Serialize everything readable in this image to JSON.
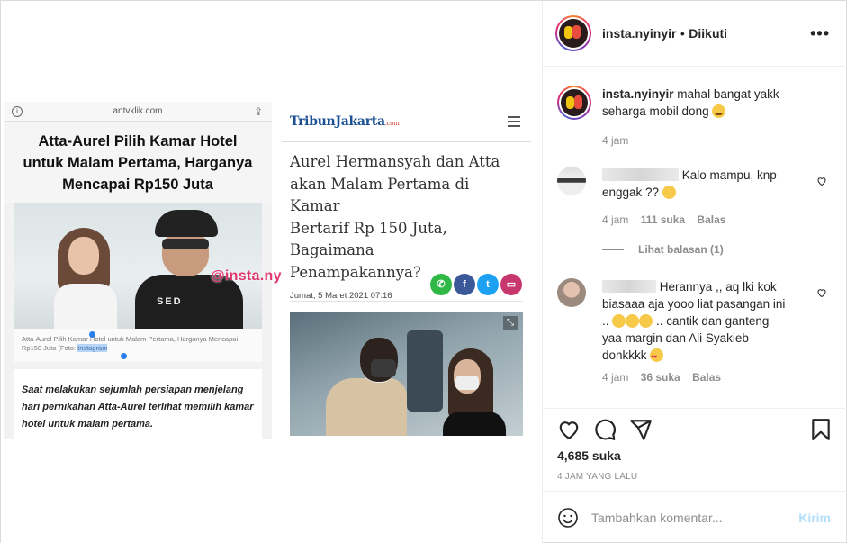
{
  "media": {
    "left_shot": {
      "url": "antvklik.com",
      "headline_lines": [
        "Atta-Aurel Pilih Kamar Hotel",
        "untuk Malam Pertama, Harganya",
        "Mencapai Rp150 Juta"
      ],
      "photo_shirt_text": "SED",
      "caption_plain": "Atta-Aurel Pilih Kamar Hotel untuk Malam Pertama, Harganya Mencapai Rp150 Juta (Foto: ",
      "caption_selected": "Instagram",
      "body_lines": [
        "Saat melakukan sejumlah persiapan menjelang",
        "hari pernikahan Atta-Aurel terlihat memilih kamar",
        "hotel untuk malam pertama."
      ]
    },
    "watermark": "@insta.nyinyir",
    "right_shot": {
      "logo": "TribunJakarta",
      "logo_suffix": ".com",
      "title_lines": [
        "Aurel Hermansyah dan Atta",
        "akan Malam Pertama di Kamar",
        "Bertarif Rp 150 Juta, Bagaimana",
        "Penampakannya?"
      ],
      "date": "Jumat, 5 Maret 2021 07:16"
    }
  },
  "header": {
    "username": "insta.nyinyir",
    "separator": "•",
    "follow_status": "Diikuti",
    "more": "•••"
  },
  "caption": {
    "username": "insta.nyinyir",
    "text_line1": "mahal bangat yakk",
    "text_line2": "seharga mobil dong",
    "time": "4 jam"
  },
  "comments": [
    {
      "text_line1": "Kalo mampu, knp",
      "text_line2": "enggak ??",
      "time": "4 jam",
      "likes": "111 suka",
      "reply": "Balas",
      "view_replies": "Lihat balasan (1)"
    },
    {
      "text_line1": "Herannya ,, aq lki kok",
      "text_line2": "biasaaa aja yooo liat pasangan ini",
      "text_line3_pre": "..",
      "text_line3_post": ".. cantik dan ganteng",
      "text_line4": "yaa margin dan Ali Syakieb",
      "text_line5": "donkkkk",
      "time": "4 jam",
      "likes": "36 suka",
      "reply": "Balas"
    }
  ],
  "actions": {
    "likes": "4,685 suka",
    "posted": "4 JAM YANG LALU"
  },
  "add_comment": {
    "placeholder": "Tambahkan komentar...",
    "send": "Kirim"
  },
  "colors": {
    "text": "#262626",
    "muted": "#8e8e8e",
    "send_disabled": "#b2dffc",
    "border": "#dbdbdb"
  }
}
